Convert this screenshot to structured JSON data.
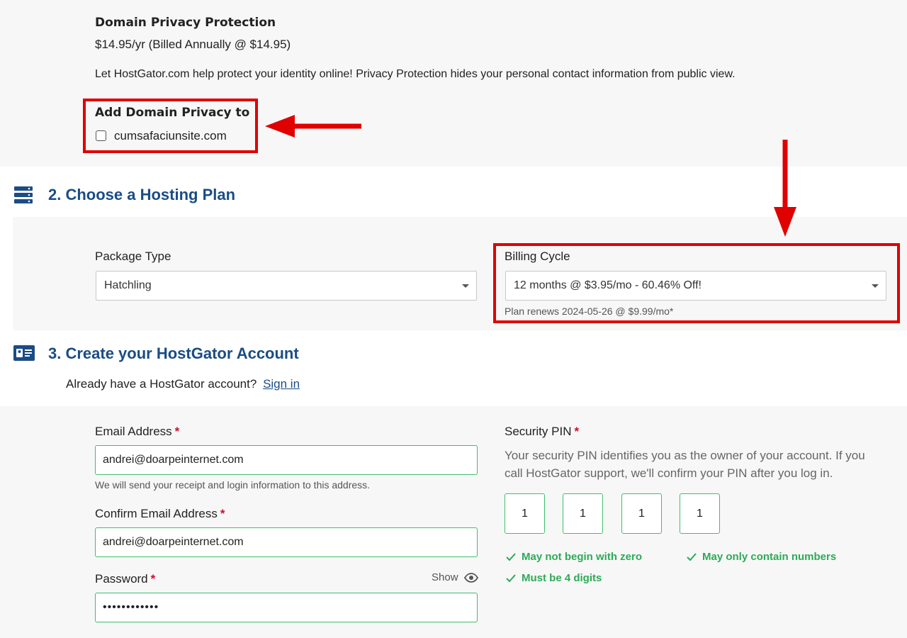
{
  "privacy": {
    "title": "Domain Privacy Protection",
    "price": "$14.95/yr (Billed Annually @ $14.95)",
    "description": "Let HostGator.com help protect your identity online! Privacy Protection hides your personal contact information from public view.",
    "add_label": "Add Domain Privacy to",
    "domain": "cumsafaciunsite.com"
  },
  "hosting": {
    "section_title": "2. Choose a Hosting Plan",
    "package_label": "Package Type",
    "package_value": "Hatchling",
    "billing_label": "Billing Cycle",
    "billing_value": "12 months @ $3.95/mo - 60.46% Off!",
    "renew_note": "Plan renews 2024-05-26 @ $9.99/mo*"
  },
  "account": {
    "section_title": "3. Create your HostGator Account",
    "already_text": "Already have a HostGator account?",
    "sign_in": "Sign in",
    "email_label": "Email Address",
    "email_value": "andrei@doarpeinternet.com",
    "email_hint": "We will send your receipt and login information to this address.",
    "confirm_label": "Confirm Email Address",
    "confirm_value": "andrei@doarpeinternet.com",
    "password_label": "Password",
    "show_label": "Show",
    "password_value": "••••••••••••",
    "required_mark": "*"
  },
  "pin": {
    "label": "Security PIN",
    "description_line1": "Your security PIN identifies you as the owner of your account. If you",
    "description_line2": "call HostGator support, we'll confirm your PIN after you log in.",
    "digits": [
      "1",
      "1",
      "1",
      "1"
    ],
    "rules": [
      "May not begin with zero",
      "May only contain numbers",
      "Must be 4 digits"
    ]
  },
  "colors": {
    "accent_blue": "#1a4c86",
    "success_green": "#2eaa57",
    "annotation_red": "#e00000"
  }
}
